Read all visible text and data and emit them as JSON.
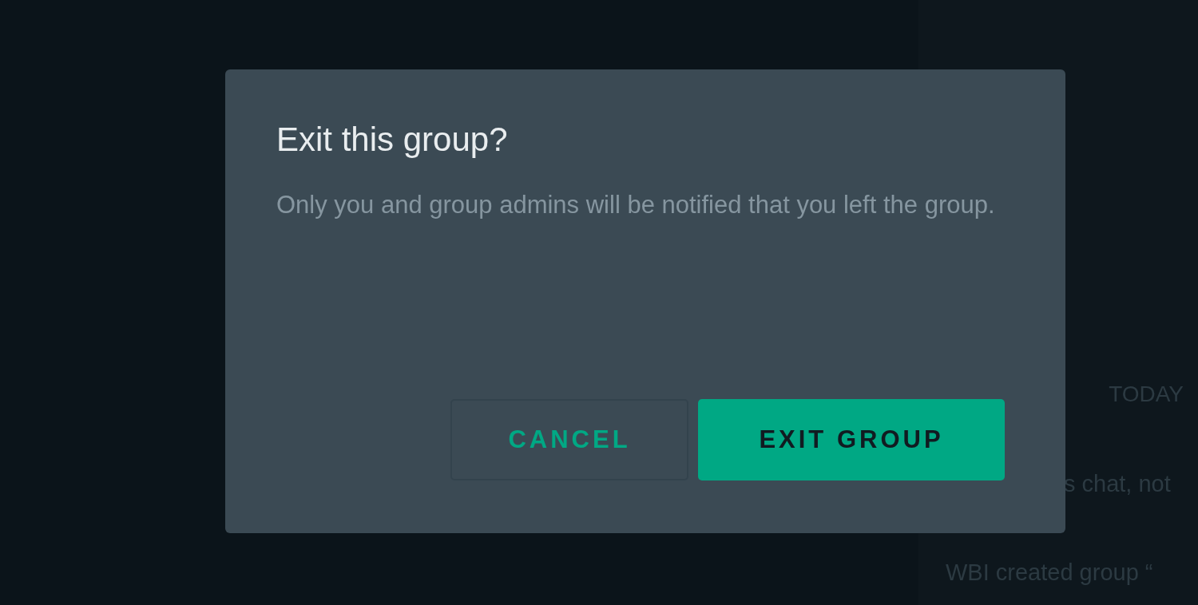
{
  "chat": {
    "date_divider": "TODAY",
    "system_messages": [
      "s chat, not",
      "WBI created group “"
    ]
  },
  "dialog": {
    "title": "Exit this group?",
    "message": "Only you and group admins will be notified that you left the group.",
    "buttons": [
      {
        "label": "CANCEL",
        "kind": "secondary"
      },
      {
        "label": "EXIT GROUP",
        "kind": "primary"
      }
    ]
  }
}
